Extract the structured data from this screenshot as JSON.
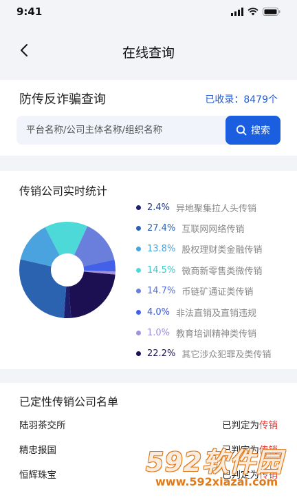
{
  "status": {
    "time": "9:41"
  },
  "nav": {
    "title": "在线查询"
  },
  "query": {
    "title": "防传反诈骗查询",
    "count": "已收录：8479个",
    "placeholder": "平台名称/公司主体名称/组织名称",
    "button": "搜索"
  },
  "stats": {
    "title": "传销公司实时统计"
  },
  "chart_data": {
    "type": "pie",
    "donut": true,
    "categories": [
      "异地聚集拉人头传销",
      "互联网网络传销",
      "股权理财类金融传销",
      "微商新零售类微传销",
      "币链矿通证类传销",
      "非法直销及直销违规",
      "教育培训精神类传销",
      "其它涉众犯罪及类传销"
    ],
    "values": [
      2.4,
      27.4,
      13.8,
      14.5,
      14.7,
      4.0,
      1.0,
      22.2
    ],
    "labels": [
      "2.4%",
      "27.4%",
      "13.8%",
      "14.5%",
      "14.7%",
      "4.0%",
      "1.0%",
      "22.2%"
    ],
    "colors": [
      "#1e1e6e",
      "#2c63b0",
      "#4aa3de",
      "#4dd9d8",
      "#6a7edb",
      "#4361e8",
      "#a094dc",
      "#1c0f52"
    ],
    "label_colors": [
      "#1f3a8a",
      "#2c63b0",
      "#4aa3de",
      "#3cc9c8",
      "#5a6fd6",
      "#3553e0",
      "#9a8ee0",
      "#1c1450"
    ],
    "legend": "right"
  },
  "list": {
    "title": "已定性传销公司名单",
    "rows": [
      {
        "name": "陆羽茶交所",
        "prefix": "已判定为",
        "tag": "传销"
      },
      {
        "name": "精忠报国",
        "prefix": "已判定为",
        "tag": "传销"
      },
      {
        "name": "恒辉珠宝",
        "prefix": "已判定为",
        "tag": "传销"
      }
    ]
  },
  "watermark": {
    "brand": "592软件园",
    "url": "www.592xiazai.com"
  }
}
